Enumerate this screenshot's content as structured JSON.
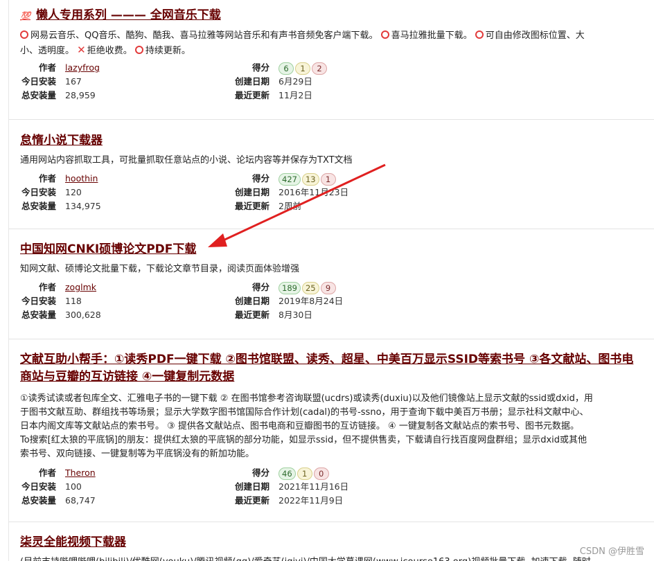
{
  "labels": {
    "author": "作者",
    "today": "今日安装",
    "total": "总安装量",
    "score": "得分",
    "created": "创建日期",
    "updated": "最近更新"
  },
  "scripts": [
    {
      "title_prefix": "💯",
      "title": "懒人专用系列 ——— 全网音乐下载",
      "desc_line1_parts": [
        "网易云音乐、QQ音乐、酷狗、酷我、喜马拉雅等网站音乐和有声书音频免客户端下载。",
        "喜马拉雅批量下载。",
        "可自由修改图标位置、大"
      ],
      "desc_line2_parts": [
        "小、透明度。",
        "拒绝收费。",
        "持续更新。"
      ],
      "author": "lazyfrog",
      "today": "167",
      "total": "28,959",
      "score_good": "6",
      "score_ok": "1",
      "score_bad": "2",
      "created": "6月29日",
      "updated": "11月2日"
    },
    {
      "title": "怠惰小说下载器",
      "desc": "通用网站内容抓取工具，可批量抓取任意站点的小说、论坛内容等并保存为TXT文档",
      "author": "hoothin",
      "today": "120",
      "total": "134,975",
      "score_good": "427",
      "score_ok": "13",
      "score_bad": "1",
      "created": "2016年11月23日",
      "updated": "2周前"
    },
    {
      "title": "中国知网CNKI硕博论文PDF下载",
      "desc": "知网文献、硕博论文批量下载，下载论文章节目录，阅读页面体验增强",
      "author": "zoglmk",
      "today": "118",
      "total": "300,628",
      "score_good": "189",
      "score_ok": "25",
      "score_bad": "9",
      "created": "2019年8月24日",
      "updated": "8月30日"
    },
    {
      "title_line1": "文献互助小帮手：①读秀PDF一键下载 ②图书馆联盟、读秀、超星、中美百万显示SSID等索书号 ③各文献站、图书电",
      "title_line2": "商站与豆瓣的互访链接 ④一键复制元数据",
      "desc_lines": [
        "①读秀试读或者包库全文、汇雅电子书的一键下载 ② 在图书馆参考咨询联盟(ucdrs)或读秀(duxiu)以及他们镜像站上显示文献的ssid或dxid，用",
        "于图书文献互助、群组找书等场景；显示大学数字图书馆国际合作计划(cadal)的书号-ssno，用于查询下载中美百万书册；显示社科文献中心、",
        "日本内阁文库等文献站点的索书号。 ③ 提供各文献站点、图书电商和豆瓣图书的互访链接。 ④ 一键复制各文献站点的索书号、图书元数据。",
        "To搜索[红太狼的平底锅]的朋友：提供红太狼的平底锅的部分功能，如显示ssid，但不提供售卖，下载请自行找百度网盘群组；显示dxid或其他",
        "索书号、双向链接、一键复制等为平底锅没有的新加功能。"
      ],
      "author": "Theron",
      "today": "100",
      "total": "68,747",
      "score_good": "46",
      "score_ok": "1",
      "score_bad": "0",
      "created": "2021年11月16日",
      "updated": "2022年11月9日"
    },
    {
      "title": "柒灵全能视频下载器",
      "desc": "(目前支持哔哩哔哩(bilibili)/优酷网(youku)/腾讯视频(qq)/爱奇艺(iqiyi)/中国大学慕课网(www.icourse163.org)视频批量下载, 加速下载, 随时"
    }
  ],
  "watermark": "CSDN @伊胜雪",
  "colors": {
    "title": "#670000",
    "arrow": "#e02020",
    "ring": "#e23b3b"
  }
}
